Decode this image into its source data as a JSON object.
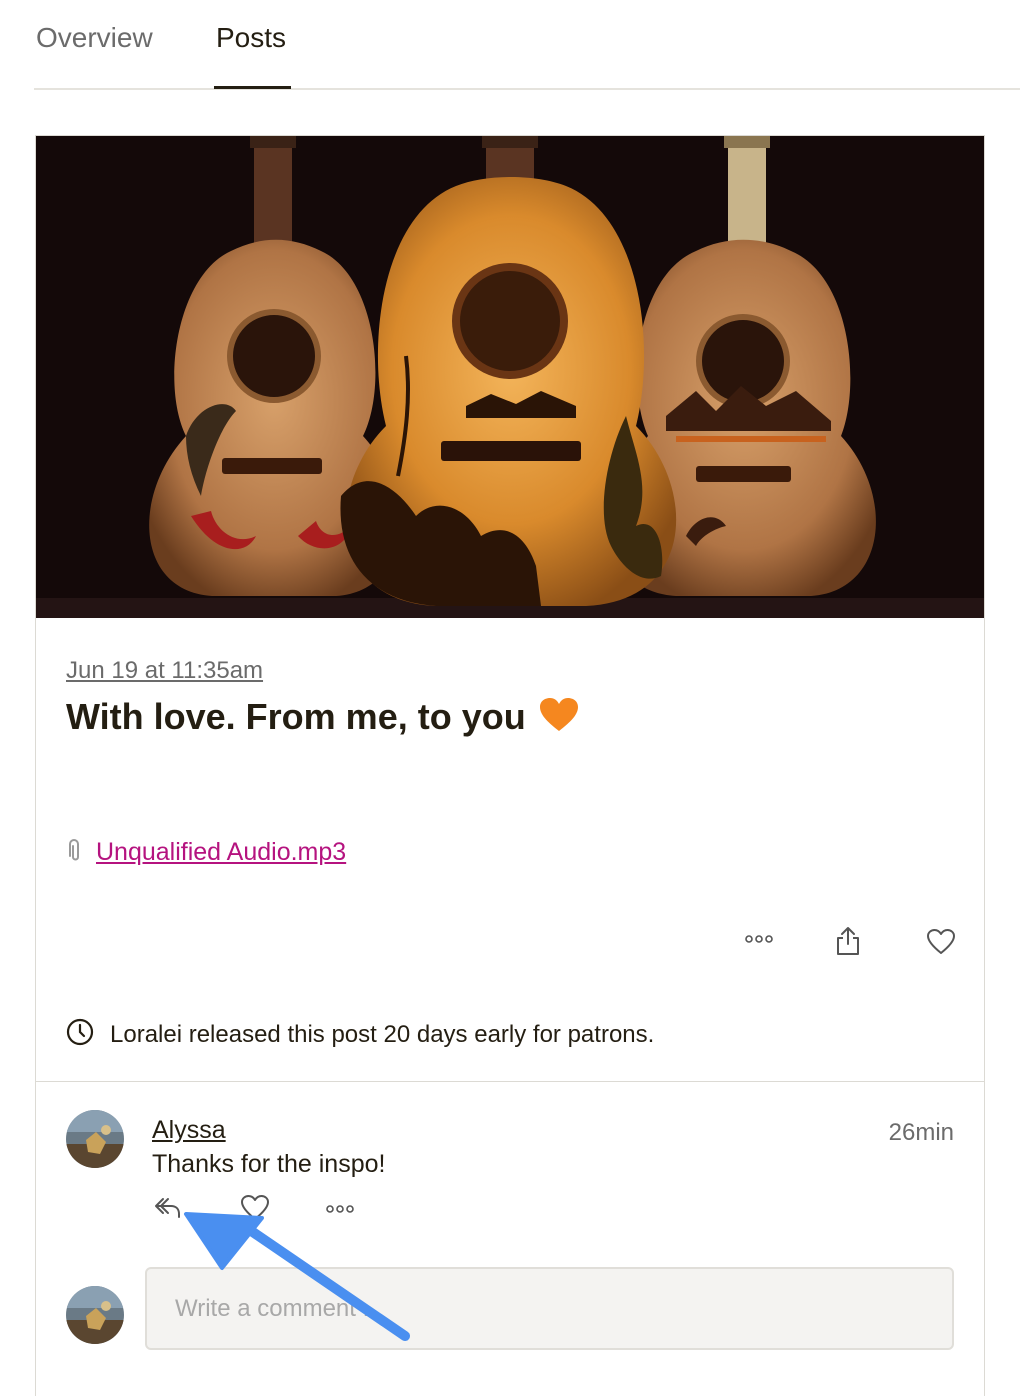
{
  "tabs": [
    {
      "label": "Overview",
      "active": false
    },
    {
      "label": "Posts",
      "active": true
    }
  ],
  "post": {
    "date": "Jun 19 at 11:35am",
    "title": "With love. From me, to you",
    "title_emoji": "orange-heart",
    "attachment": {
      "icon": "paperclip-icon",
      "label": "Unqualified Audio.mp3"
    },
    "actions": [
      {
        "name": "more-options",
        "icon": "ellipsis-icon"
      },
      {
        "name": "share",
        "icon": "share-icon"
      },
      {
        "name": "like",
        "icon": "heart-outline-icon"
      }
    ],
    "release_note": "Loralei released this post 20 days early for patrons."
  },
  "comments": [
    {
      "author": "Alyssa",
      "time": "26min",
      "text": "Thanks for the inspo!",
      "actions": [
        "reply-icon",
        "heart-outline-icon",
        "ellipsis-icon"
      ]
    }
  ],
  "comment_input": {
    "placeholder": "Write a comment ..."
  },
  "colors": {
    "text": "#241e12",
    "muted": "#6b6b6b",
    "link": "#b5137f",
    "annotation_arrow": "#4a8ff0"
  }
}
